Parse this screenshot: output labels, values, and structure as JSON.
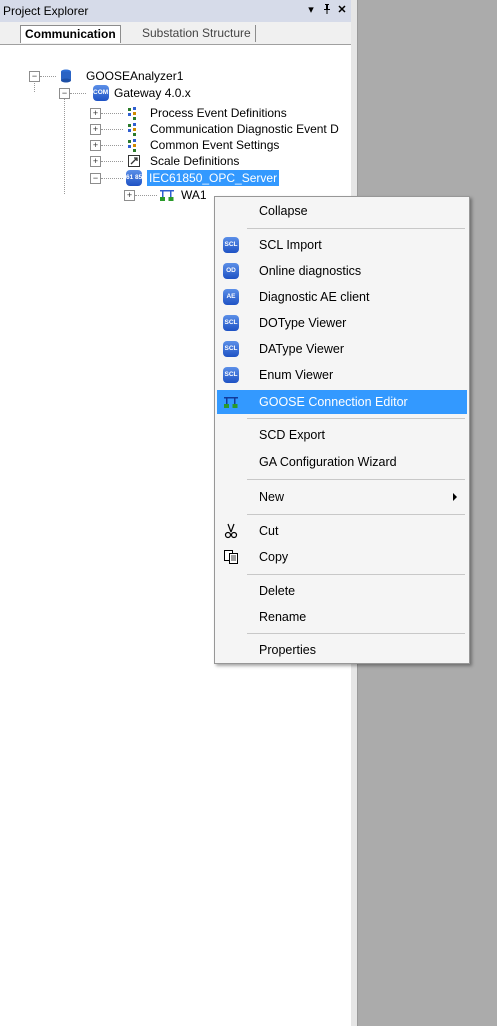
{
  "panel": {
    "title": "Project Explorer",
    "buttons": {
      "dropdown": "▾",
      "pin": "ᵖ",
      "close": "✕"
    }
  },
  "tabs": [
    {
      "label": "Communication",
      "active": true
    },
    {
      "label": "Substation Structure",
      "active": false
    }
  ],
  "tree": {
    "root": {
      "label": "GOOSEAnalyzer1",
      "icon": "database-icon"
    },
    "gateway": {
      "label": "Gateway 4.0.x",
      "icon": "gateway-icon",
      "icon_text": "COM 600"
    },
    "children": [
      {
        "label": "Process Event Definitions",
        "icon": "event-definitions-icon"
      },
      {
        "label": "Communication Diagnostic Event D",
        "icon": "diagnostic-event-icon"
      },
      {
        "label": "Common Event Settings",
        "icon": "event-settings-icon"
      },
      {
        "label": "Scale Definitions",
        "icon": "scale-definitions-icon"
      }
    ],
    "server": {
      "label": "IEC61850_OPC_Server",
      "icon": "iec61850-server-icon",
      "icon_text": "61 850"
    },
    "subnode": {
      "label": "WA1",
      "icon": "network-icon"
    }
  },
  "context_menu": {
    "items": [
      {
        "label": "Collapse"
      },
      {
        "label": "SCL Import",
        "icon_text": "SCL"
      },
      {
        "label": "Online diagnostics",
        "icon_text": "OD"
      },
      {
        "label": "Diagnostic AE client",
        "icon_text": "AE"
      },
      {
        "label": "DOType Viewer",
        "icon_text": "SCL"
      },
      {
        "label": "DAType Viewer",
        "icon_text": "SCL"
      },
      {
        "label": "Enum Viewer",
        "icon_text": "SCL"
      },
      {
        "label": "GOOSE Connection Editor",
        "highlighted": true
      },
      {
        "label": "SCD Export"
      },
      {
        "label": "GA Configuration Wizard"
      },
      {
        "label": "New",
        "submenu": true
      },
      {
        "label": "Cut"
      },
      {
        "label": "Copy"
      },
      {
        "label": "Delete"
      },
      {
        "label": "Rename"
      },
      {
        "label": "Properties"
      }
    ]
  },
  "colors": {
    "selection": "#3399ff",
    "titlebar": "#d6dbe9",
    "workspace": "#ababab"
  }
}
